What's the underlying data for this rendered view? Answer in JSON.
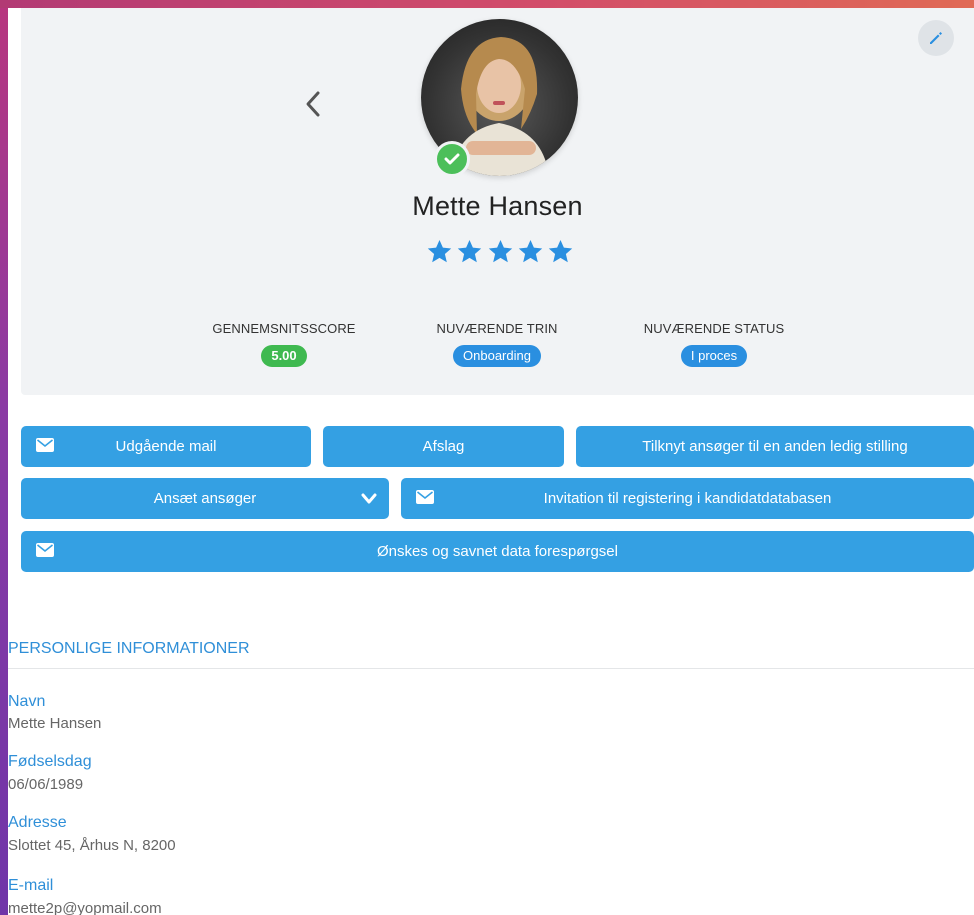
{
  "profile": {
    "name": "Mette Hansen",
    "rating": 5,
    "rating_max": 5,
    "verified": true
  },
  "stats": {
    "score_label": "GENNEMSNITSSCORE",
    "score_value": "5.00",
    "step_label": "NUVÆRENDE TRIN",
    "step_value": "Onboarding",
    "status_label": "NUVÆRENDE STATUS",
    "status_value": "I proces"
  },
  "actions": {
    "outgoing_mail": "Udgående mail",
    "reject": "Afslag",
    "link_other_position": "Tilknyt ansøger til en anden ledig stilling",
    "hire": "Ansæt ansøger",
    "invite_candidate_db": "Invitation til registering i kandidatdatabasen",
    "request_missing_data": "Ønskes og savnet data forespørgsel"
  },
  "personal": {
    "title": "PERSONLIGE INFORMATIONER",
    "name_label": "Navn",
    "name_value": "Mette Hansen",
    "birthday_label": "Fødselsdag",
    "birthday_value": "06/06/1989",
    "address_label": "Adresse",
    "address_value": "Slottet 45, Århus N, 8200",
    "email_label": "E-mail",
    "email_value": "mette2p@yopmail.com"
  },
  "icons": {
    "back": "chevron-left-icon",
    "edit": "pencil-icon",
    "verified": "check-icon",
    "star": "star-icon",
    "mail": "mail-icon",
    "dropdown": "chevron-down-icon"
  },
  "colors": {
    "accent": "#34a0e3",
    "label_blue": "#2f8fd8",
    "success": "#3fb950",
    "pill_blue": "#2a8fe0",
    "star": "#2a8fe0",
    "card_bg": "#f1f3f5"
  }
}
